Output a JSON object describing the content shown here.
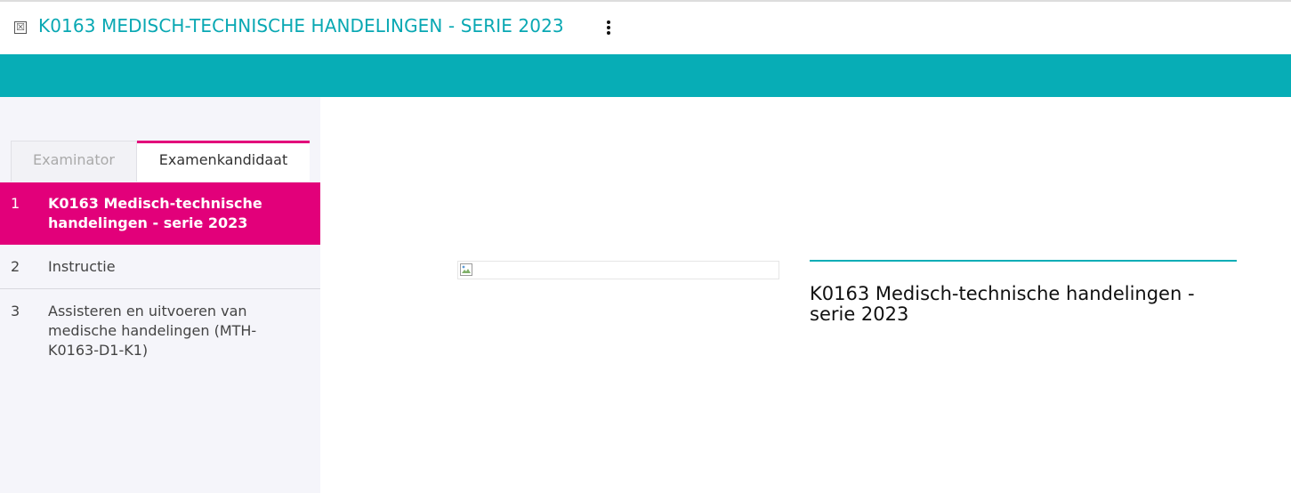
{
  "header": {
    "title": "K0163 MEDISCH-TECHNISCHE HANDELINGEN - SERIE 2023",
    "close_glyph": "☒",
    "close_icon": "close-box-icon",
    "menu_icon": "kebab-menu-icon"
  },
  "colors": {
    "accent_teal": "#07adb6",
    "accent_magenta": "#e2007a",
    "sidebar_bg": "#f5f5fa"
  },
  "tabs": [
    {
      "label": "Examinator",
      "active": false
    },
    {
      "label": "Examenkandidaat",
      "active": true
    }
  ],
  "nav": [
    {
      "number": "1",
      "label": "K0163 Medisch-technische handelingen - serie 2023",
      "active": true
    },
    {
      "number": "2",
      "label": "Instructie",
      "active": false
    },
    {
      "number": "3",
      "label": "Assisteren en uitvoeren van medische handelingen (MTH-K0163-D1-K1)",
      "active": false
    }
  ],
  "content": {
    "image_icon": "broken-image-icon",
    "title": "K0163 Medisch-technische handelingen - serie 2023"
  }
}
